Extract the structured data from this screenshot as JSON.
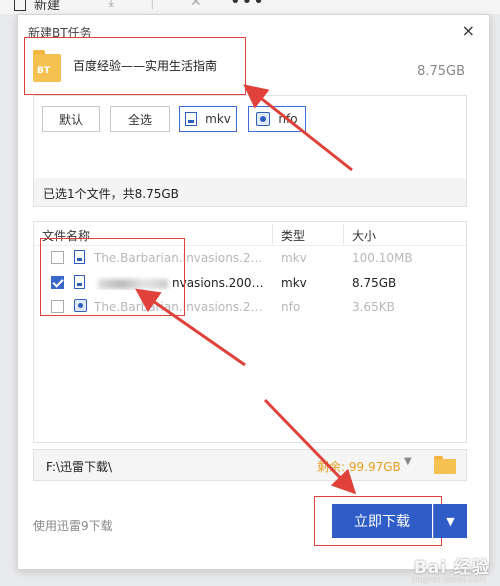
{
  "toolbar": {
    "new_label": "新建"
  },
  "dialog": {
    "title": "新建BT任务",
    "close": "×"
  },
  "torrent": {
    "name": "百度经验——实用生活指南",
    "size": "8.75GB",
    "badge": "BT"
  },
  "filters": {
    "buttons": [
      {
        "label": "默认",
        "selected": false
      },
      {
        "label": "全选",
        "selected": false
      },
      {
        "label": "mkv",
        "selected": true,
        "icon": "video-file-icon"
      },
      {
        "label": "nfo",
        "selected": true,
        "icon": "nfo-file-icon"
      }
    ],
    "summary": "已选1个文件，共8.75GB"
  },
  "file_list": {
    "columns": {
      "name": "文件名称",
      "type": "类型",
      "size": "大小"
    },
    "rows": [
      {
        "name": "The.Barbarian.Invasions.2003.Bl...",
        "type": "mkv",
        "size": "100.10MB",
        "checked": false
      },
      {
        "name_suffix": "nvasions.2003.Bl...",
        "type": "mkv",
        "size": "8.75GB",
        "checked": true
      },
      {
        "name": "The.Barbarian.Invasions.2003.Bl...",
        "type": "nfo",
        "size": "3.65KB",
        "checked": false
      }
    ]
  },
  "path": {
    "value": "F:\\迅雷下载\\",
    "free": "剩余: 99.97GB"
  },
  "footer": {
    "use_xunlei": "使用迅雷9下载",
    "download": "立即下载"
  },
  "colors": {
    "primary": "#2f5cc6",
    "annotation": "#e0413a",
    "free_space": "#e6a020"
  },
  "watermark": {
    "text": "Bai 经验",
    "sub": "jingyan.baidu.com"
  }
}
